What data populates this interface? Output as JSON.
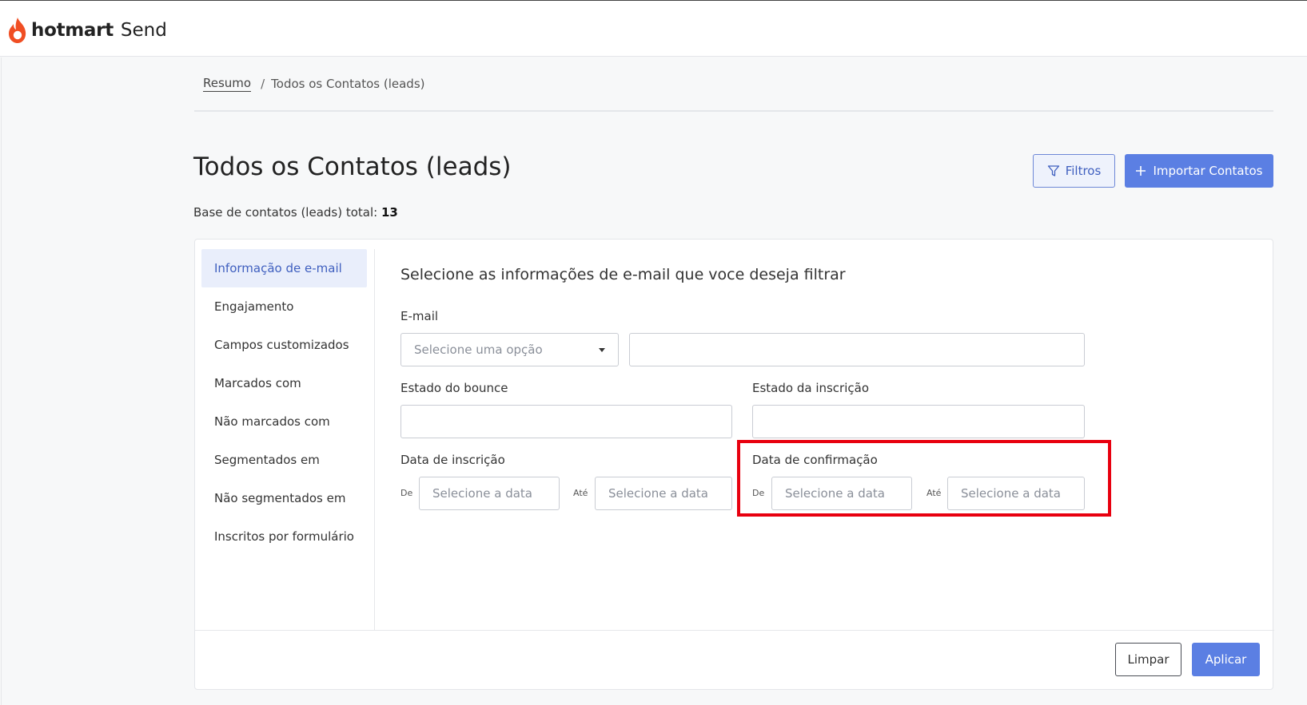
{
  "header": {
    "brand": "hotmart",
    "product": "Send",
    "logo_icon": "flame-icon",
    "accent_color": "#f04e23"
  },
  "breadcrumb": {
    "root": "Resumo",
    "separator": "/",
    "current": "Todos os Contatos (leads)"
  },
  "page": {
    "title": "Todos os Contatos (leads)",
    "total_label": "Base de contatos (leads) total:",
    "total_value": "13"
  },
  "actions": {
    "filters_label": "Filtros",
    "filters_icon": "filter-icon",
    "import_label": "Importar Contatos",
    "import_icon": "plus-icon",
    "primary_color": "#5b7fe3"
  },
  "filter_menu": {
    "items": [
      {
        "label": "Informação de e-mail",
        "active": true
      },
      {
        "label": "Engajamento",
        "active": false
      },
      {
        "label": "Campos customizados",
        "active": false
      },
      {
        "label": "Marcados com",
        "active": false
      },
      {
        "label": "Não marcados com",
        "active": false
      },
      {
        "label": "Segmentados em",
        "active": false
      },
      {
        "label": "Não segmentados em",
        "active": false
      },
      {
        "label": "Inscritos por formulário",
        "active": false
      }
    ]
  },
  "form": {
    "heading": "Selecione as informações de e-mail que voce deseja filtrar",
    "email": {
      "label": "E-mail",
      "select_placeholder": "Selecione uma opção",
      "value": ""
    },
    "bounce": {
      "label": "Estado do bounce",
      "value": ""
    },
    "subscription_state": {
      "label": "Estado da inscrição",
      "value": ""
    },
    "subscription_date": {
      "label": "Data de inscrição",
      "from_label": "De",
      "to_label": "Até",
      "from_placeholder": "Selecione a data",
      "to_placeholder": "Selecione a data"
    },
    "confirmation_date": {
      "label": "Data de confirmação",
      "from_label": "De",
      "to_label": "Até",
      "from_placeholder": "Selecione a data",
      "to_placeholder": "Selecione a data",
      "highlight_color": "#e8000f"
    }
  },
  "footer": {
    "clear_label": "Limpar",
    "apply_label": "Aplicar"
  }
}
